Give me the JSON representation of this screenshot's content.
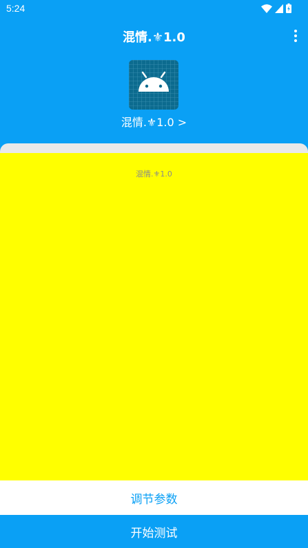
{
  "status_bar": {
    "time": "5:24",
    "icons": [
      "wifi-icon",
      "cellular-signal-icon",
      "battery-charging-icon"
    ]
  },
  "toolbar": {
    "title": "混情.⚜1.0",
    "menu_icon": "more-vert-icon"
  },
  "header": {
    "app_icon": "android-robot-icon",
    "app_name": "混情.⚜1.0 >"
  },
  "content": {
    "label": "混情.⚜1.0"
  },
  "buttons": {
    "adjust_label": "调节参数",
    "start_label": "开始测试"
  },
  "colors": {
    "primary": "#0aa0f5",
    "content_background": "#ffff00",
    "icon_background": "#0c6b8f"
  }
}
